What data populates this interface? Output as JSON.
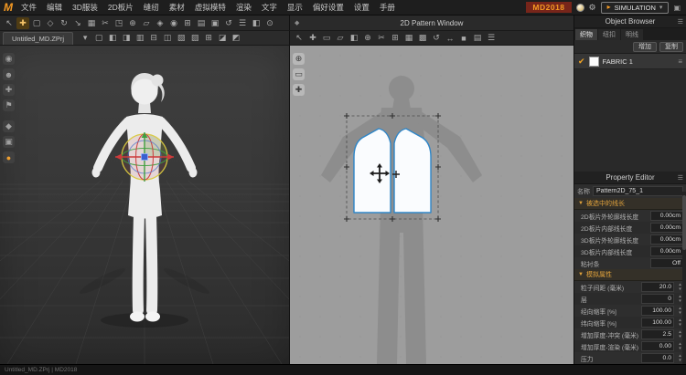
{
  "icons": {
    "gear": "⚙",
    "caret_down": "▾",
    "play": "▸",
    "menu": "☰",
    "check": "✔",
    "section_open": "▼",
    "step_up": "▴",
    "step_down": "▾",
    "window_menu": "◆",
    "handle": "≡",
    "layout": "▣"
  },
  "menubar": {
    "logo": "M",
    "items": [
      "文件",
      "编辑",
      "3D服装",
      "2D板片",
      "缝纫",
      "素材",
      "虚拟模特",
      "渲染",
      "文字",
      "显示",
      "偏好设置",
      "设置",
      "手册"
    ],
    "brand": "MD2018",
    "simulation_label": "SIMULATION"
  },
  "toolbar3d": {
    "row1": [
      "↖",
      "✚",
      "▢",
      "◇",
      "↻",
      "↘",
      "▦",
      "✂",
      "◳",
      "⊕",
      "▱",
      "◈",
      "◉",
      "⊞",
      "▤",
      "▣",
      "↺",
      "☰",
      "◧",
      "⊙"
    ],
    "doc_tab": "Untitled_MD.ZPrj",
    "row2": [
      "▾",
      "▢",
      "◧",
      "◨",
      "▥",
      "⊟",
      "◫",
      "▧",
      "▨",
      "⊞",
      "◪",
      "◩"
    ],
    "side": [
      "◉",
      "☻",
      "✚",
      "⚑",
      "◆",
      "▣",
      "●"
    ]
  },
  "window2d": {
    "title": "2D Pattern Window",
    "toolbar": [
      "↖",
      "✚",
      "▭",
      "▱",
      "◧",
      "⊕",
      "✂",
      "⊞",
      "▦",
      "▩",
      "↺",
      "↔",
      "■",
      "▤",
      "☰"
    ],
    "side": [
      "⊕",
      "▭",
      "✚"
    ]
  },
  "object_browser": {
    "title": "Object Browser",
    "tabs": {
      "fabric": "织物",
      "button": "纽扣",
      "topstitch": "明线"
    },
    "add_button": "增加",
    "copy_button": "复制",
    "fabric_item": "FABRIC 1"
  },
  "property_editor": {
    "title": "Property Editor",
    "name_label": "名称",
    "name_value": "Pattern2D_75_1",
    "section_lengths": {
      "title": "被选中的线长",
      "rows": [
        {
          "label": "2D板片外轮廓线长度",
          "value": "0.00cm"
        },
        {
          "label": "2D板片内部线长度",
          "value": "0.00cm"
        },
        {
          "label": "3D板片外轮廓线长度",
          "value": "0.00cm"
        },
        {
          "label": "3D板片内部线长度",
          "value": "0.00cm"
        },
        {
          "label": "粘衬条",
          "value": "Off"
        }
      ]
    },
    "section_sim": {
      "title": "模拟属性",
      "rows": [
        {
          "label": "粒子间距 (毫米)",
          "value": "20.0"
        },
        {
          "label": "层",
          "value": "0"
        },
        {
          "label": "经向缩率 [%]",
          "value": "100.00"
        },
        {
          "label": "纬向缩率 [%]",
          "value": "100.00"
        },
        {
          "label": "增加厚度-冲突 (毫米)",
          "value": "2.5"
        },
        {
          "label": "增加厚度-渲染 (毫米)",
          "value": "0.00"
        },
        {
          "label": "压力",
          "value": "0.0"
        }
      ]
    }
  },
  "statusbar": {
    "left": "Untitled_MD.ZPrj  |  MD2018"
  },
  "colors": {
    "accent": "#f59a23",
    "pattern_outline": "#2e86c8",
    "gizmo_red": "#cc3b3b",
    "gizmo_green": "#3f9f3f",
    "gizmo_blue": "#3a5fd0",
    "gizmo_yellow": "#d9c93e"
  }
}
